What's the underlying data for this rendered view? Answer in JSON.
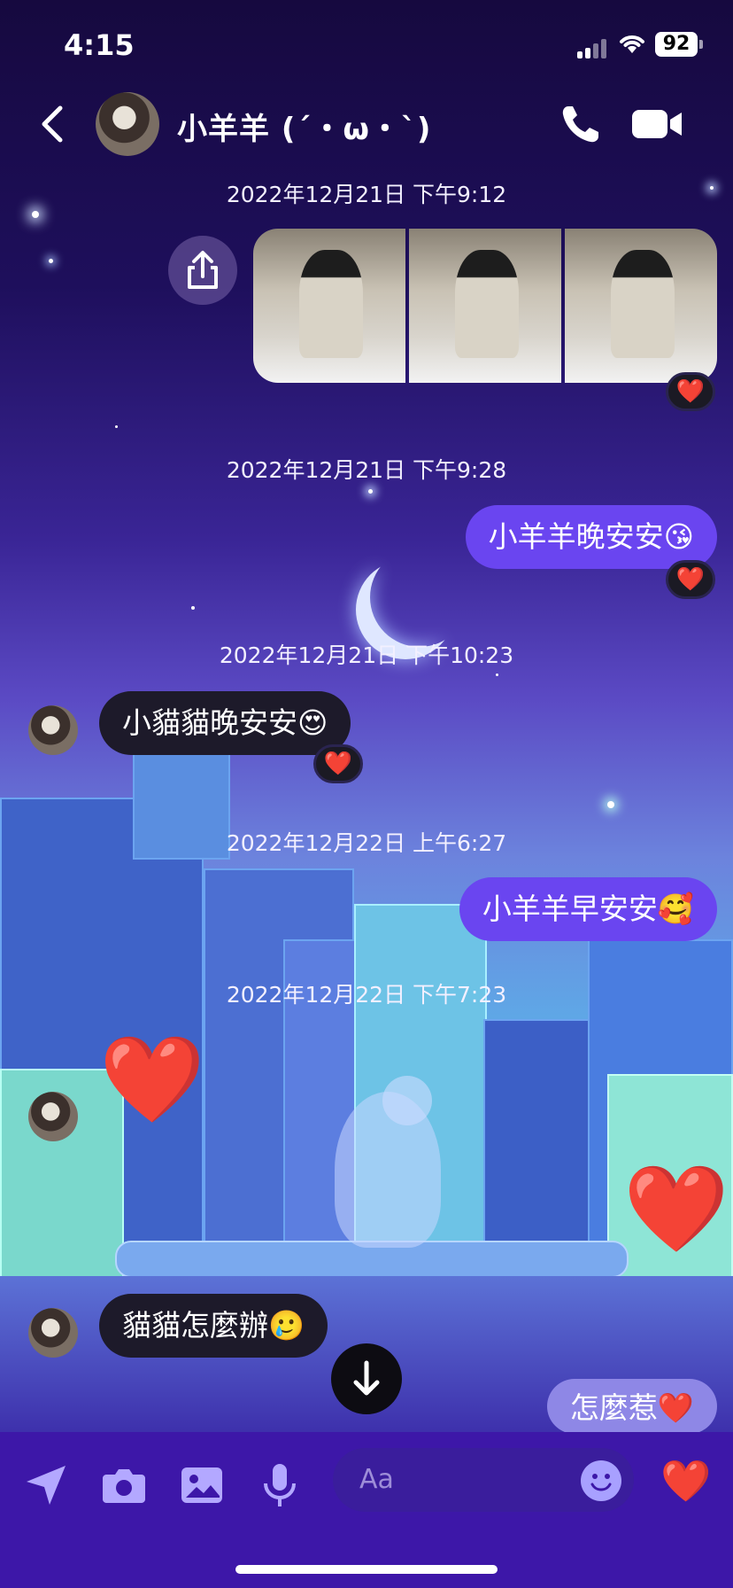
{
  "status_bar": {
    "time": "4:15",
    "battery": "92"
  },
  "header": {
    "contact_name": "小羊羊 (´・ω・`)"
  },
  "messages": {
    "ts1": "2022年12月21日 下午9:12",
    "ts2": "2022年12月21日 下午9:28",
    "msg_goodnight_mine": "小羊羊晚安安😘",
    "ts3": "2022年12月21日 下午10:23",
    "msg_goodnight_theirs": "小貓貓晚安安😍",
    "ts4": "2022年12月22日 上午6:27",
    "msg_morning_mine": "小羊羊早安安🥰",
    "ts5": "2022年12月22日 下午7:23",
    "msg_what_theirs": "貓貓怎麼辦🥲",
    "msg_what_mine": "怎麼惹❤️"
  },
  "reactions": {
    "heart": "❤️"
  },
  "composer": {
    "placeholder": "Aa",
    "like": "❤️"
  },
  "colors": {
    "accent": "#6a45f0",
    "their_bubble": "#1d1a2a"
  }
}
